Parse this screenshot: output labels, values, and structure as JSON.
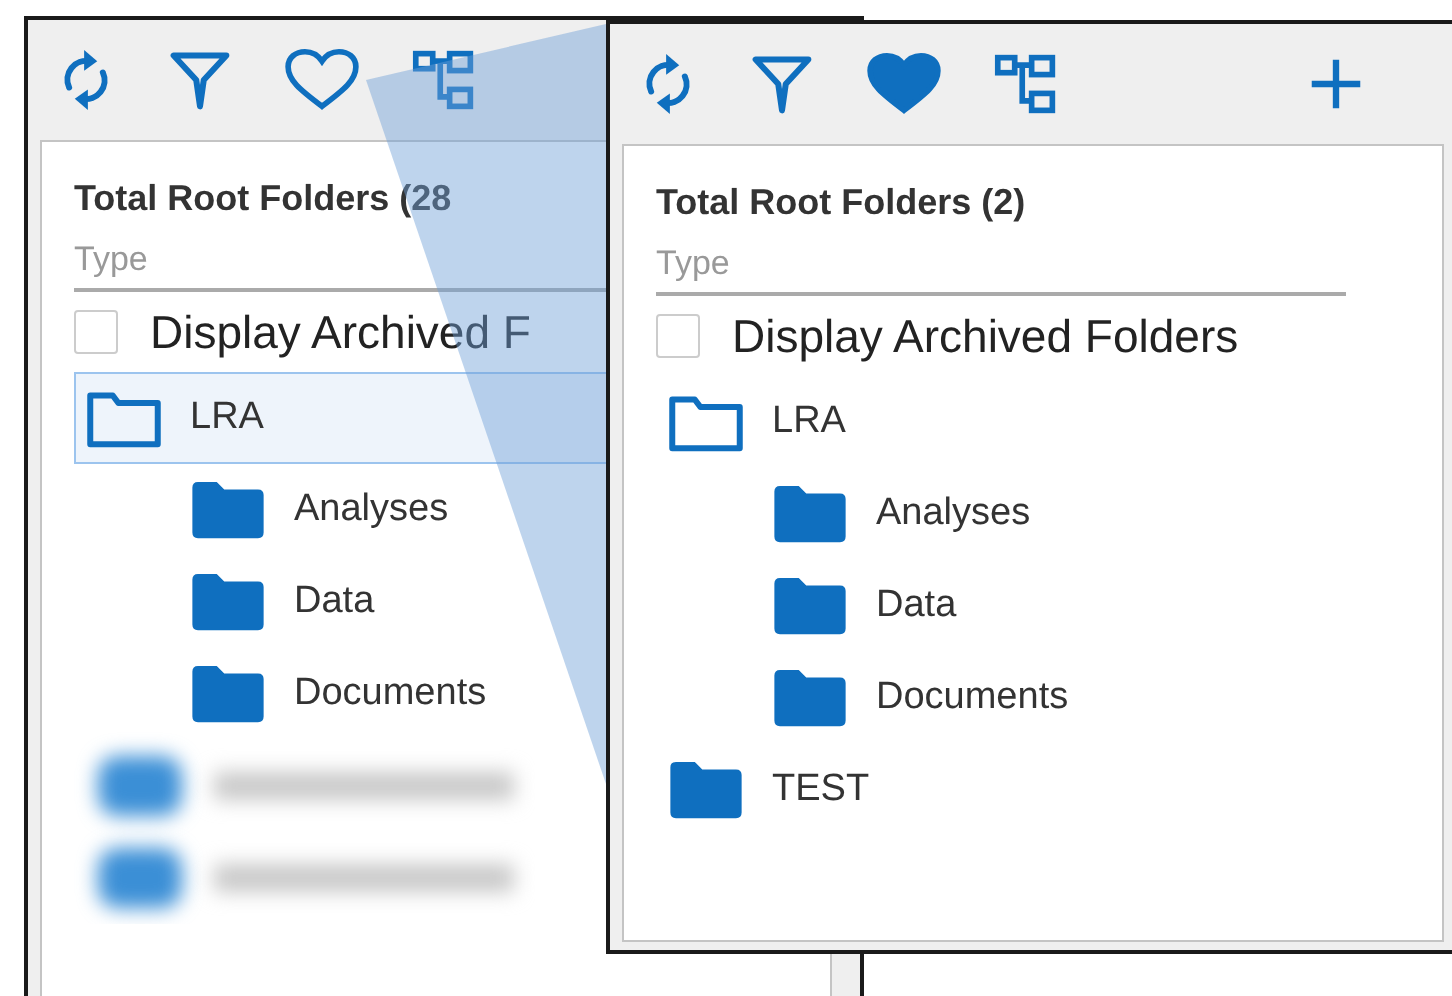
{
  "windows": [
    {
      "tools": [
        {
          "kind": "refresh"
        },
        {
          "kind": "filter"
        },
        {
          "kind": "favorite",
          "on": false
        },
        {
          "kind": "hierarchy"
        }
      ],
      "title": "Total Root Folders (28",
      "filter": {
        "placeholder": "Type"
      },
      "archived": {
        "label": "Display Archived F",
        "checked": false
      },
      "tree": [
        {
          "kind": "folder",
          "label": "LRA",
          "selected": true,
          "expanded": true,
          "children": [
            {
              "kind": "folder",
              "label": "Analyses",
              "selected": false,
              "expanded": false
            },
            {
              "kind": "folder",
              "label": "Data",
              "selected": false,
              "expanded": false
            },
            {
              "kind": "folder",
              "label": "Documents",
              "selected": false,
              "expanded": false
            }
          ]
        },
        {
          "kind": "redacted"
        },
        {
          "kind": "redacted"
        }
      ]
    },
    {
      "tools": [
        {
          "kind": "refresh"
        },
        {
          "kind": "filter"
        },
        {
          "kind": "favorite",
          "on": true
        },
        {
          "kind": "hierarchy"
        },
        {
          "kind": "add"
        }
      ],
      "title": "Total Root Folders (2)",
      "filter": {
        "placeholder": "Type"
      },
      "archived": {
        "label": "Display Archived Folders",
        "checked": false
      },
      "tree": [
        {
          "kind": "folder",
          "label": "LRA",
          "selected": false,
          "expanded": true,
          "children": [
            {
              "kind": "folder",
              "label": "Analyses",
              "selected": false,
              "expanded": false
            },
            {
              "kind": "folder",
              "label": "Data",
              "selected": false,
              "expanded": false
            },
            {
              "kind": "folder",
              "label": "Documents",
              "selected": false,
              "expanded": false
            }
          ]
        },
        {
          "kind": "folder",
          "label": "TEST",
          "selected": false,
          "expanded": false
        }
      ]
    }
  ]
}
